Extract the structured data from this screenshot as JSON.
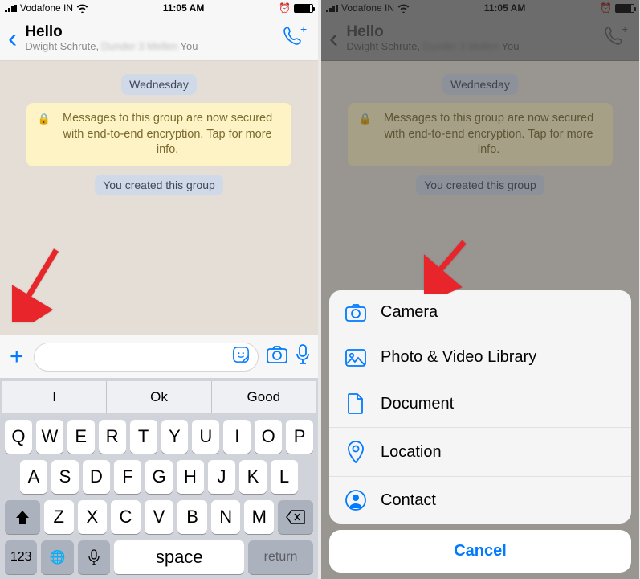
{
  "status": {
    "carrier": "Vodafone IN",
    "time": "11:05 AM"
  },
  "header": {
    "title": "Hello",
    "subtitle_p1": "Dwight Schrute,",
    "subtitle_blur": "Dunder 3 Mellen",
    "subtitle_p2": "You"
  },
  "chat": {
    "day": "Wednesday",
    "notice": "Messages to this group are now secured with end-to-end encryption. Tap for more info.",
    "created": "You created this group"
  },
  "keyboard": {
    "preds": [
      "I",
      "Ok",
      "Good"
    ],
    "row1": [
      "Q",
      "W",
      "E",
      "R",
      "T",
      "Y",
      "U",
      "I",
      "O",
      "P"
    ],
    "row2": [
      "A",
      "S",
      "D",
      "F",
      "G",
      "H",
      "J",
      "K",
      "L"
    ],
    "row3": [
      "Z",
      "X",
      "C",
      "V",
      "B",
      "N",
      "M"
    ],
    "numKey": "123",
    "space": "space",
    "return": "return"
  },
  "sheet": {
    "items": [
      {
        "icon": "camera",
        "label": "Camera"
      },
      {
        "icon": "photo",
        "label": "Photo & Video Library"
      },
      {
        "icon": "document",
        "label": "Document"
      },
      {
        "icon": "location",
        "label": "Location"
      },
      {
        "icon": "contact",
        "label": "Contact"
      }
    ],
    "cancel": "Cancel"
  }
}
